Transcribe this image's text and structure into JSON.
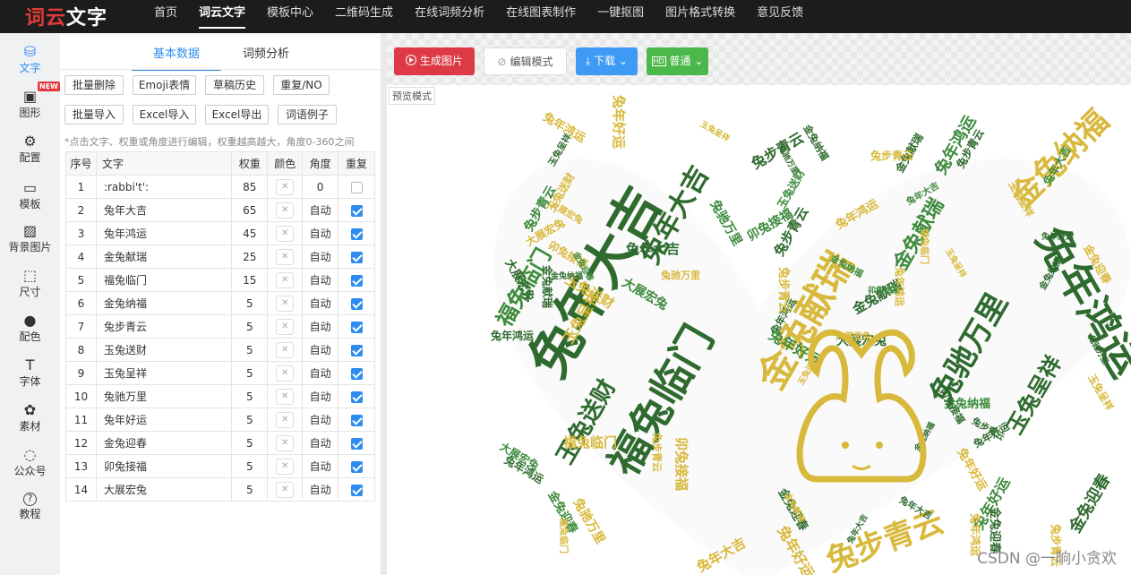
{
  "header": {
    "logo": "词云文字",
    "nav": [
      "首页",
      "词云文字",
      "模板中心",
      "二维码生成",
      "在线词频分析",
      "在线图表制作",
      "一键抠图",
      "图片格式转换",
      "意见反馈"
    ]
  },
  "sidebar": {
    "items": [
      {
        "label": "文字",
        "icon": "database-icon"
      },
      {
        "label": "图形",
        "icon": "image-icon",
        "badge": "NEW"
      },
      {
        "label": "配置",
        "icon": "gear-icon"
      },
      {
        "label": "模板",
        "icon": "template-icon"
      },
      {
        "label": "背景图片",
        "icon": "background-icon"
      },
      {
        "label": "尺寸",
        "icon": "size-icon"
      },
      {
        "label": "配色",
        "icon": "color-icon"
      },
      {
        "label": "字体",
        "icon": "font-icon"
      },
      {
        "label": "素材",
        "icon": "material-icon"
      },
      {
        "label": "公众号",
        "icon": "wechat-icon"
      },
      {
        "label": "教程",
        "icon": "help-icon"
      }
    ]
  },
  "panel": {
    "tabs": [
      "基本数据",
      "词频分析"
    ],
    "buttons_row1": [
      "批量删除",
      "Emoji表情",
      "草稿历史",
      "重复/NO"
    ],
    "buttons_row2": [
      "批量导入",
      "Excel导入",
      "Excel导出",
      "词语例子"
    ],
    "hint": "*点击文字、权重或角度进行编辑，权重越高越大，角度0-360之间",
    "table": {
      "headers": [
        "序号",
        "文字",
        "权重",
        "颜色",
        "角度",
        "重复"
      ],
      "rows": [
        {
          "no": "1",
          "word": ":rabbi't':",
          "weight": "85",
          "angle": "0",
          "repeat": false
        },
        {
          "no": "2",
          "word": "兔年大吉",
          "weight": "65",
          "angle": "自动",
          "repeat": true
        },
        {
          "no": "3",
          "word": "兔年鸿运",
          "weight": "45",
          "angle": "自动",
          "repeat": true
        },
        {
          "no": "4",
          "word": "金兔献瑞",
          "weight": "25",
          "angle": "自动",
          "repeat": true
        },
        {
          "no": "5",
          "word": "福兔临门",
          "weight": "15",
          "angle": "自动",
          "repeat": true
        },
        {
          "no": "6",
          "word": "金兔纳福",
          "weight": "5",
          "angle": "自动",
          "repeat": true
        },
        {
          "no": "7",
          "word": "兔步青云",
          "weight": "5",
          "angle": "自动",
          "repeat": true
        },
        {
          "no": "8",
          "word": "玉兔送财",
          "weight": "5",
          "angle": "自动",
          "repeat": true
        },
        {
          "no": "9",
          "word": "玉兔呈祥",
          "weight": "5",
          "angle": "自动",
          "repeat": true
        },
        {
          "no": "10",
          "word": "兔驰万里",
          "weight": "5",
          "angle": "自动",
          "repeat": true
        },
        {
          "no": "11",
          "word": "兔年好运",
          "weight": "5",
          "angle": "自动",
          "repeat": true
        },
        {
          "no": "12",
          "word": "金兔迎春",
          "weight": "5",
          "angle": "自动",
          "repeat": true
        },
        {
          "no": "13",
          "word": "卯兔接福",
          "weight": "5",
          "angle": "自动",
          "repeat": true
        },
        {
          "no": "14",
          "word": "大展宏兔",
          "weight": "5",
          "angle": "自动",
          "repeat": true
        }
      ]
    }
  },
  "toolbar": {
    "generate": "生成图片",
    "edit_mode": "编辑模式",
    "download": "下载",
    "quality": "普通",
    "preview_mode": "预览模式"
  },
  "watermark": "CSDN @一晌小贪欢",
  "colors": {
    "dark_green": "#2f6b2f",
    "green": "#3d8b3d",
    "gold": "#d8b93c",
    "accent_blue": "#2d8cf0",
    "red": "#e03b3b"
  }
}
